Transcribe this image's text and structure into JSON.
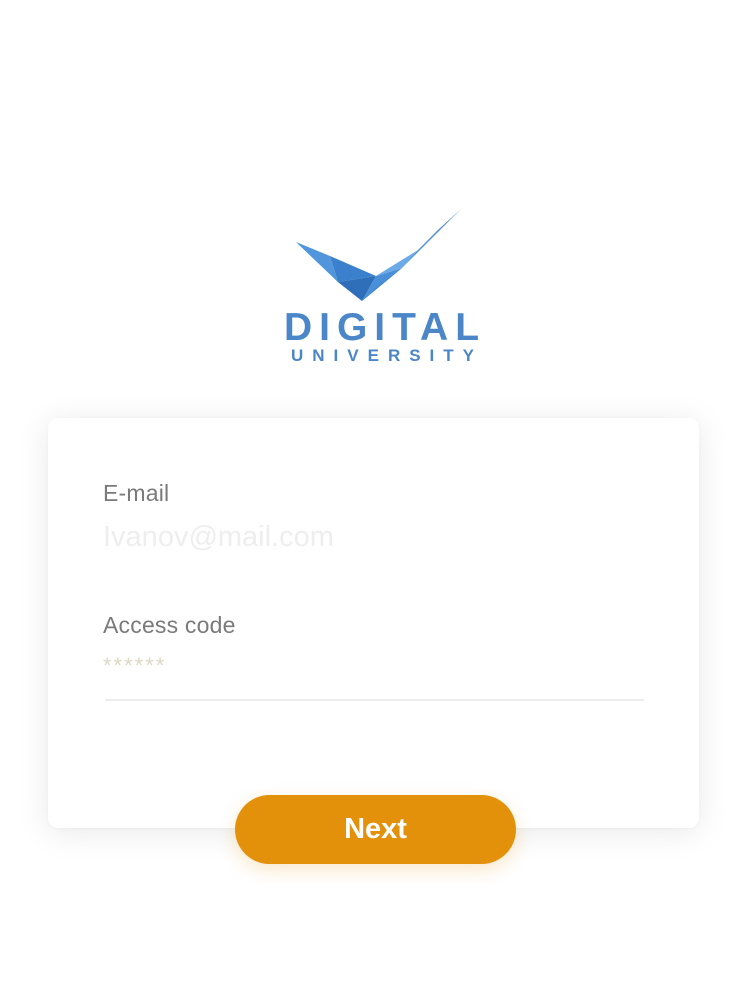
{
  "brand": {
    "name_line1": "DIGITAL",
    "name_line2": "UNIVERSITY",
    "logo_icon": "checkmark-wing-icon",
    "color": "#4a86c8"
  },
  "form": {
    "email_label": "E-mail",
    "email_placeholder": "Ivanov@mail.com",
    "code_label": "Access code",
    "code_placeholder": "******"
  },
  "actions": {
    "next_label": "Next",
    "accent_color": "#e3910a"
  }
}
